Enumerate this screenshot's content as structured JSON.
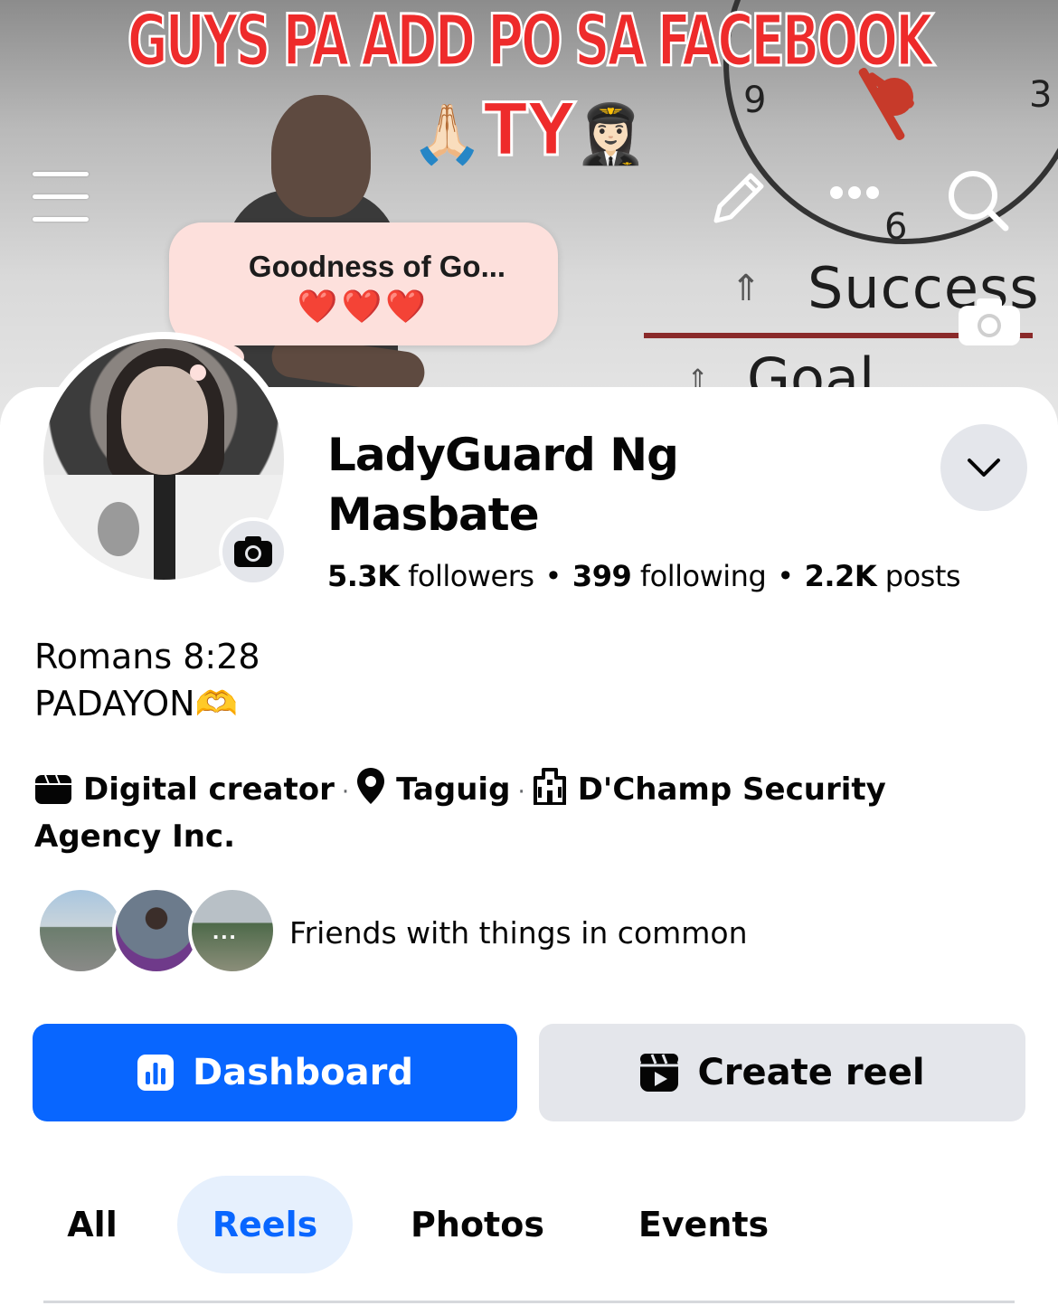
{
  "overlay": {
    "headline_line1": "GUYS PA ADD PO SA FACEBOOK",
    "headline_line2": "TY",
    "emoji_pray": "🙏🏻",
    "emoji_pilot": "👩🏻‍✈️"
  },
  "cover": {
    "text_success": "Success",
    "text_goal": "Goal",
    "clock_num_3": "3",
    "clock_num_6": "6",
    "clock_num_9": "9"
  },
  "note": {
    "text": "Goodness of Go...",
    "hearts": "❤️❤️❤️"
  },
  "profile": {
    "name": "LadyGuard Ng Masbate",
    "followers_count": "5.3K",
    "followers_label": "followers",
    "following_count": "399",
    "following_label": "following",
    "posts_count": "2.2K",
    "posts_label": "posts",
    "bio_line1": "Romans 8:28",
    "bio_line2": "PADAYON🫶"
  },
  "details": {
    "category": "Digital creator",
    "location": "Taguig",
    "workplace": "D'Champ Security Agency Inc."
  },
  "friends": {
    "text": "Friends with things in common",
    "more_dots": "..."
  },
  "buttons": {
    "dashboard": "Dashboard",
    "create_reel": "Create reel"
  },
  "tabs": [
    {
      "label": "All",
      "selected": false
    },
    {
      "label": "Reels",
      "selected": true
    },
    {
      "label": "Photos",
      "selected": false
    },
    {
      "label": "Events",
      "selected": false
    }
  ],
  "colors": {
    "primary_blue": "#0866ff",
    "headline_red": "#ee2b2b",
    "note_bubble": "#fde0dc",
    "secondary_button": "#e4e6eb"
  }
}
